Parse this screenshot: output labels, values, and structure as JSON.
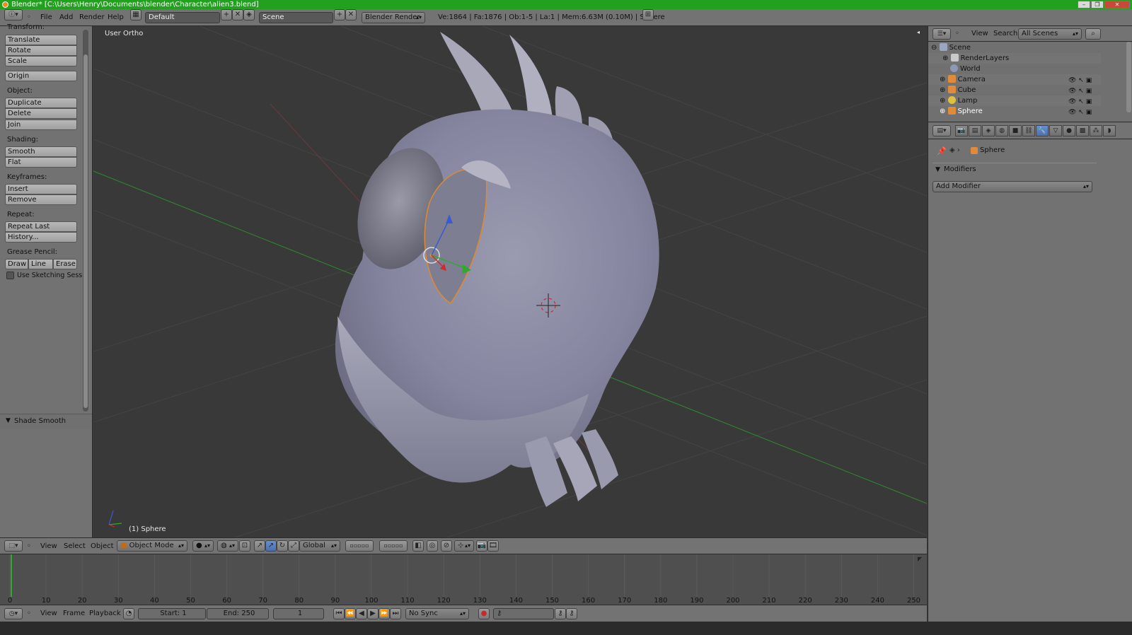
{
  "window": {
    "title": "Blender* [C:\\Users\\Henry\\Documents\\blender\\Character\\alien3.blend]",
    "controls": [
      "–",
      "❐",
      "✕"
    ]
  },
  "info_header": {
    "menus": [
      "File",
      "Add",
      "Render",
      "Help"
    ],
    "layout": "Default",
    "scene": "Scene",
    "engine": "Blender Render",
    "stats": "Ve:1864 | Fa:1876 | Ob:1-5 | La:1 | Mem:6.63M (0.10M) | Sphere"
  },
  "tool_shelf": {
    "transform": {
      "heading": "Transform:",
      "buttons": [
        "Translate",
        "Rotate",
        "Scale"
      ],
      "origin": "Origin"
    },
    "object": {
      "heading": "Object:",
      "buttons": [
        "Duplicate",
        "Delete",
        "Join"
      ]
    },
    "shading": {
      "heading": "Shading:",
      "buttons": [
        "Smooth",
        "Flat"
      ]
    },
    "keyframes": {
      "heading": "Keyframes:",
      "buttons": [
        "Insert",
        "Remove"
      ]
    },
    "repeat": {
      "heading": "Repeat:",
      "buttons": [
        "Repeat Last",
        "History..."
      ]
    },
    "grease": {
      "heading": "Grease Pencil:",
      "buttons": [
        "Draw",
        "Line",
        "Erase"
      ],
      "checkbox": "Use Sketching Sessio"
    },
    "last_op": "Shade Smooth"
  },
  "viewport": {
    "view_label": "User Ortho",
    "object_label": "(1) Sphere"
  },
  "view3d_header": {
    "menus": [
      "View",
      "Select",
      "Object"
    ],
    "mode": "Object Mode",
    "orientation": "Global"
  },
  "timeline": {
    "ticks": [
      "0",
      "10",
      "20",
      "30",
      "40",
      "50",
      "60",
      "70",
      "80",
      "90",
      "100",
      "110",
      "120",
      "130",
      "140",
      "150",
      "160",
      "170",
      "180",
      "190",
      "200",
      "210",
      "220",
      "230",
      "240",
      "250"
    ],
    "current_frame": 1,
    "menus": [
      "View",
      "Frame",
      "Playback"
    ],
    "start": "Start: 1",
    "end": "End: 250",
    "frame": "1",
    "sync": "No Sync"
  },
  "outliner": {
    "menus": [
      "View",
      "Search"
    ],
    "filter": "All Scenes",
    "items": [
      {
        "label": "Scene",
        "color": "#9aa7c0"
      },
      {
        "label": "RenderLayers",
        "color": "#c9c9c9"
      },
      {
        "label": "World",
        "color": "#8a9ab5"
      },
      {
        "label": "Camera",
        "color": "#e08a3c"
      },
      {
        "label": "Cube",
        "color": "#e08a3c"
      },
      {
        "label": "Lamp",
        "color": "#e0c03c"
      },
      {
        "label": "Sphere",
        "color": "#e08a3c"
      }
    ]
  },
  "properties": {
    "context": "Sphere",
    "panel": "Modifiers",
    "add_modifier": "Add Modifier"
  }
}
